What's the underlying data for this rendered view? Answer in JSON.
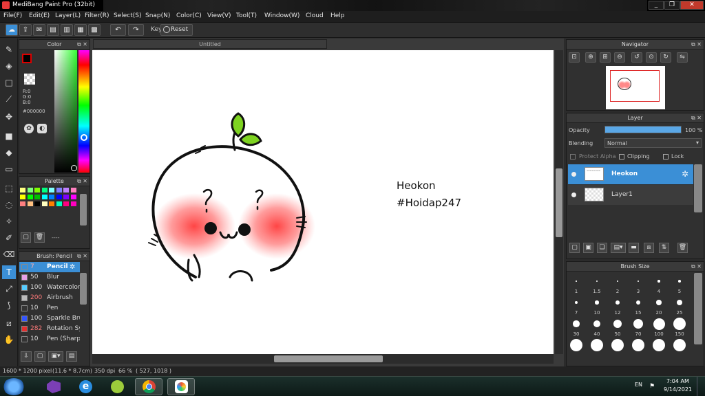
{
  "window": {
    "title": "MediBang Paint Pro (32bit)",
    "buttons": [
      "_",
      "❐",
      "✕"
    ]
  },
  "menu": [
    "File(F)",
    "Edit(E)",
    "Layer(L)",
    "Filter(R)",
    "Select(S)",
    "Snap(N)",
    "Color(C)",
    "View(V)",
    "Tool(T)",
    "Window(W)",
    "Cloud",
    "Help"
  ],
  "toolbar": {
    "key_label": "Key",
    "reset_label": "Reset"
  },
  "document": {
    "tab_title": "Untitled",
    "canvas_text_1": "Heokon",
    "canvas_text_2": "#Hoidap247"
  },
  "color_panel": {
    "title": "Color",
    "r": "R:0",
    "g": "G:0",
    "b": "B:0",
    "hex": "#000000"
  },
  "palette_panel": {
    "title": "Palette",
    "footer": "----"
  },
  "brush_panel": {
    "title": "Brush: Pencil",
    "items": [
      {
        "size": "7",
        "name": "Pencil",
        "color": "#3b8fd6"
      },
      {
        "size": "50",
        "name": "Blur",
        "color": "#e8a0e8"
      },
      {
        "size": "100",
        "name": "Watercolor",
        "color": "#55ccff"
      },
      {
        "size": "200",
        "name": "Airbrush",
        "color": "#bbbbbb"
      },
      {
        "size": "10",
        "name": "Pen",
        "color": "#333333"
      },
      {
        "size": "100",
        "name": "Sparkle Bru",
        "color": "#3355ff"
      },
      {
        "size": "282",
        "name": "Rotation Sy",
        "color": "#e03030"
      },
      {
        "size": "10",
        "name": "Pen (Sharp",
        "color": "#333333"
      }
    ]
  },
  "navigator": {
    "title": "Navigator"
  },
  "layer_panel": {
    "title": "Layer",
    "opacity_label": "Opacity",
    "opacity_value": "100 %",
    "opacity_fraction": 1.0,
    "blending_label": "Blending",
    "blending_value": "Normal",
    "protect_alpha": "Protect Alpha",
    "clipping": "Clipping",
    "lock": "Lock",
    "layers": [
      {
        "name": "Heokon",
        "selected": true
      },
      {
        "name": "Layer1",
        "selected": false
      }
    ]
  },
  "brush_size": {
    "title": "Brush Size",
    "labels": [
      "1",
      "1.5",
      "2",
      "3",
      "4",
      "5",
      "7",
      "10",
      "12",
      "15",
      "20",
      "25",
      "30",
      "40",
      "50",
      "70",
      "100",
      "150"
    ]
  },
  "status": {
    "dims": "1600 * 1200 pixel",
    "cm": "(11.6 * 8.7cm)",
    "dpi": "350 dpi",
    "zoom": "66 %",
    "coords": "( 527, 1018 )"
  },
  "taskbar": {
    "lang": "EN",
    "time": "7:04 AM",
    "date": "9/14/2021"
  }
}
